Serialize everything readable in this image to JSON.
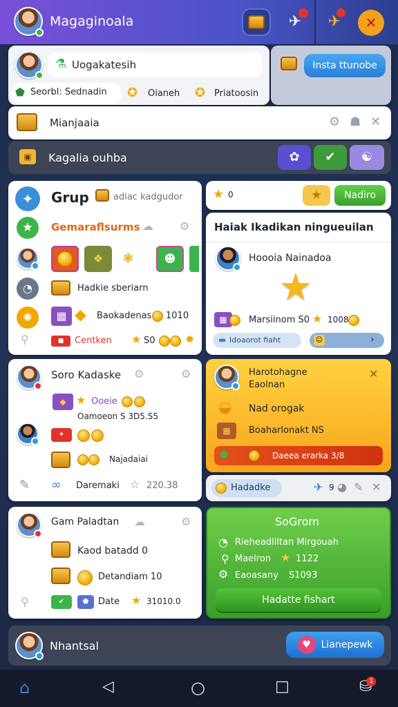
{
  "header": {
    "title": "Magaginoala",
    "accent": "#6a4fd8"
  },
  "profile": {
    "name": "Uogakatesih",
    "tabs": [
      "Seorbl: Sednadin",
      "Oianeh",
      "Priatoosin"
    ],
    "action_label": "Insta ttunobe"
  },
  "search": {
    "value": "Mianjaaia"
  },
  "section_bar": {
    "label": "Kagalia ouhba"
  },
  "group_card": {
    "title": "Grup",
    "subtitle": "adiac kadgudor",
    "heading": "Gemaraflsurms",
    "row1_label": "Hadkie sberiarn",
    "row2_label": "Baokadenas",
    "row2_value": "1010",
    "footer_left": "Centken",
    "footer_value": "S0"
  },
  "top_right_strip": {
    "star_count": "0",
    "button_label": "Nadiro"
  },
  "event_card": {
    "title": "Haiak Ikadikan ningueuilan",
    "person": "Hoooia Nainadoa",
    "footer_text": "Marsiinom S0",
    "footer_value": "1008",
    "progress_label": "Idoaorot fiaht"
  },
  "sora_card": {
    "title": "Soro Kadaske",
    "value1": "Ooeie",
    "label1": "Oamoeon S 3D5.S5",
    "label2": "Najadaiai",
    "label3": "Daremaki",
    "value3": "220.38"
  },
  "orange_card": {
    "title": "Harotohagne",
    "subtitle": "Eaolnan",
    "row1": "Nad orogak",
    "row2": "Boaharlonakt NS",
    "banner": "Daeea erarka 3/8"
  },
  "notify_strip": {
    "label": "Hadadke",
    "count": "9"
  },
  "gam_card": {
    "title": "Gam Paladtan",
    "row1": "Kaod batadd 0",
    "row2": "Detandiam 10",
    "row3": "Date",
    "row3_value": "31010.0"
  },
  "green_card": {
    "title": "SoGrom",
    "line1": "Rieheadliltan Mirgouah",
    "line2": "Maelron",
    "line2_value": "1122",
    "line3": "Eaoasany",
    "line3_value": "S1093",
    "button_label": "Hadatte fishart"
  },
  "bottom_banner": {
    "label": "Nhantsal",
    "button_label": "Lianepewk"
  },
  "navbar": {
    "badge": "1"
  }
}
